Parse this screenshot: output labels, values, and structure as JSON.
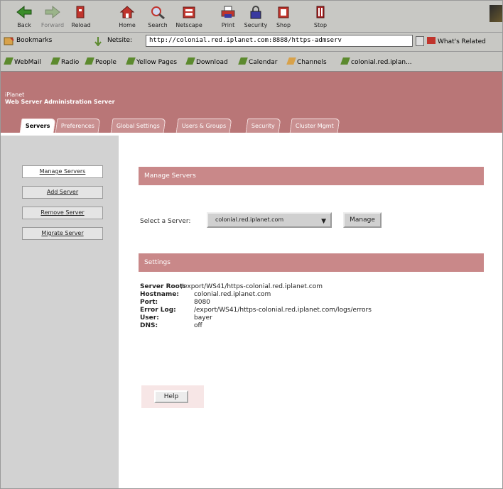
{
  "toolbar": {
    "buttons": [
      {
        "label": "Back",
        "icon": "back-arrow-icon",
        "color": "#3b8d2a",
        "enabled": true
      },
      {
        "label": "Forward",
        "icon": "forward-arrow-icon",
        "color": "#9bb48a",
        "enabled": false
      },
      {
        "label": "Reload",
        "icon": "reload-icon",
        "color": "#c0342c",
        "enabled": true
      },
      {
        "label": "Home",
        "icon": "home-icon",
        "color": "#c0342c",
        "enabled": true
      },
      {
        "label": "Search",
        "icon": "search-icon",
        "color": "#c0342c",
        "enabled": true
      },
      {
        "label": "Netscape",
        "icon": "netscape-icon",
        "color": "#c0342c",
        "enabled": true
      },
      {
        "label": "Print",
        "icon": "print-icon",
        "color": "#3a3aa0",
        "enabled": true
      },
      {
        "label": "Security",
        "icon": "lock-icon",
        "color": "#3a3aa0",
        "enabled": true
      },
      {
        "label": "Shop",
        "icon": "shop-icon",
        "color": "#c0342c",
        "enabled": true
      },
      {
        "label": "Stop",
        "icon": "stop-icon",
        "color": "#a82020",
        "enabled": true
      }
    ]
  },
  "location": {
    "bookmarks_label": "Bookmarks",
    "netsite_label": "Netsite:",
    "url": "http://colonial.red.iplanet.com:8888/https-admserv",
    "related_label": "What's Related"
  },
  "personal_toolbar": [
    {
      "label": "WebMail",
      "icon": "webmail-icon"
    },
    {
      "label": "Radio",
      "icon": "radio-icon"
    },
    {
      "label": "People",
      "icon": "people-icon"
    },
    {
      "label": "Yellow Pages",
      "icon": "yellow-pages-icon"
    },
    {
      "label": "Download",
      "icon": "download-icon"
    },
    {
      "label": "Calendar",
      "icon": "calendar-icon"
    },
    {
      "label": "Channels",
      "icon": "channels-icon"
    },
    {
      "label": "colonial.red.iplan...",
      "icon": "bookmark-icon"
    }
  ],
  "header": {
    "brand": "iPlanet",
    "title": "Web Server Administration Server",
    "color": "#b97677"
  },
  "tabs": [
    {
      "label": "Servers",
      "active": true
    },
    {
      "label": "Preferences",
      "active": false
    },
    {
      "label": "Global Settings",
      "active": false
    },
    {
      "label": "Users & Groups",
      "active": false
    },
    {
      "label": "Security",
      "active": false
    },
    {
      "label": "Cluster Mgmt",
      "active": false
    }
  ],
  "leftnav": [
    {
      "label": "Manage Servers",
      "active": true
    },
    {
      "label": "Add Server",
      "active": false
    },
    {
      "label": "Remove Server",
      "active": false
    },
    {
      "label": "Migrate Server",
      "active": false
    }
  ],
  "main": {
    "manage_title": "Manage Servers",
    "select_label": "Select a Server:",
    "selected_server": "colonial.red.iplanet.com",
    "manage_button": "Manage",
    "settings_title": "Settings",
    "settings": [
      {
        "key": "Server Root:",
        "value": "/export/WS41/https-colonial.red.iplanet.com"
      },
      {
        "key": "Hostname:",
        "value": "colonial.red.iplanet.com"
      },
      {
        "key": "Port:",
        "value": "8080"
      },
      {
        "key": "Error Log:",
        "value": "/export/WS41/https-colonial.red.iplanet.com/logs/errors"
      },
      {
        "key": "User:",
        "value": "bayer"
      },
      {
        "key": "DNS:",
        "value": "off"
      }
    ],
    "help_button": "Help"
  },
  "colors": {
    "accent_bar": "#c98889",
    "nav_bg": "#d2d2d2",
    "chrome_bg": "#c8c8c4"
  }
}
